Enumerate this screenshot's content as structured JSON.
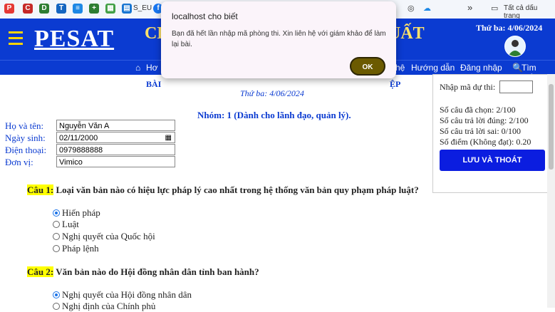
{
  "bookmarks": {
    "items": [
      {
        "icon": "p-icon",
        "color": "#e53935",
        "glyph": "P"
      },
      {
        "icon": "c-icon",
        "color": "#c62828",
        "glyph": "C"
      },
      {
        "icon": "d-icon",
        "color": "#2e7d32",
        "glyph": "D"
      },
      {
        "icon": "t-icon",
        "color": "#1565c0",
        "glyph": "T"
      },
      {
        "icon": "doc-icon",
        "color": "#1e88e5",
        "glyph": "≡"
      },
      {
        "icon": "sheet-icon",
        "color": "#2e7d32",
        "glyph": "+"
      },
      {
        "icon": "grid-icon",
        "color": "#43a047",
        "glyph": "▦"
      }
    ],
    "seu_label": "S_EU",
    "more_glyph": "»",
    "all_bookmarks_label": "Tất cả dấu trang"
  },
  "header": {
    "logo": "PESAT",
    "title_left": "CH",
    "title_right": "UẤT",
    "date": "Thứ ba: 4/06/2024"
  },
  "nav": {
    "home": "Hơ",
    "partial": "hệ",
    "guide": "Hướng dẫn",
    "login": "Đăng nhập",
    "search": "Tìm kiếm"
  },
  "content": {
    "title": "BÀI",
    "title_end": "ỆP",
    "date": "Thứ ba: 4/06/2024",
    "group": "Nhóm: 1 (Dành cho lãnh đạo, quản lý).",
    "form": {
      "name_label": "Họ và tên:",
      "name_value": "Nguyễn Văn A",
      "dob_label": "Ngày sinh:",
      "dob_value": "02/11/2000",
      "phone_label": "Điện thoại:",
      "phone_value": "0979888888",
      "unit_label": "Đơn vị:",
      "unit_value": "Vimico"
    },
    "questions": [
      {
        "num": "Câu 1:",
        "text": "Loại văn bản nào có hiệu lực pháp lý cao nhất trong hệ thống văn bản quy phạm pháp luật?",
        "options": [
          {
            "label": "Hiến pháp",
            "selected": true
          },
          {
            "label": "Luật",
            "selected": false
          },
          {
            "label": "Nghị quyết của Quốc hội",
            "selected": false
          },
          {
            "label": "Pháp lệnh",
            "selected": false
          }
        ]
      },
      {
        "num": "Câu 2:",
        "text": "Văn bản nào do Hội đồng nhân dân tỉnh ban hành?",
        "options": [
          {
            "label": "Nghị quyết của Hội đồng nhân dân",
            "selected": true
          },
          {
            "label": "Nghị định của Chính phủ",
            "selected": false
          }
        ]
      }
    ]
  },
  "panel": {
    "code_label": "Nhập mã dự thi:",
    "selected": "Số câu đã chọn: 2/100",
    "correct": "Số câu trả lời đúng: 2/100",
    "wrong": "Số câu trả lời sai: 0/100",
    "score": "Số điểm (Không đạt): 0.20",
    "save_button": "LƯU VÀ THOÁT"
  },
  "dialog": {
    "title": "localhost cho biết",
    "message": "Bạn đã hết lần nhập mã phòng thi. Xin liên hệ với giám khảo để làm lại bài.",
    "ok": "OK"
  }
}
